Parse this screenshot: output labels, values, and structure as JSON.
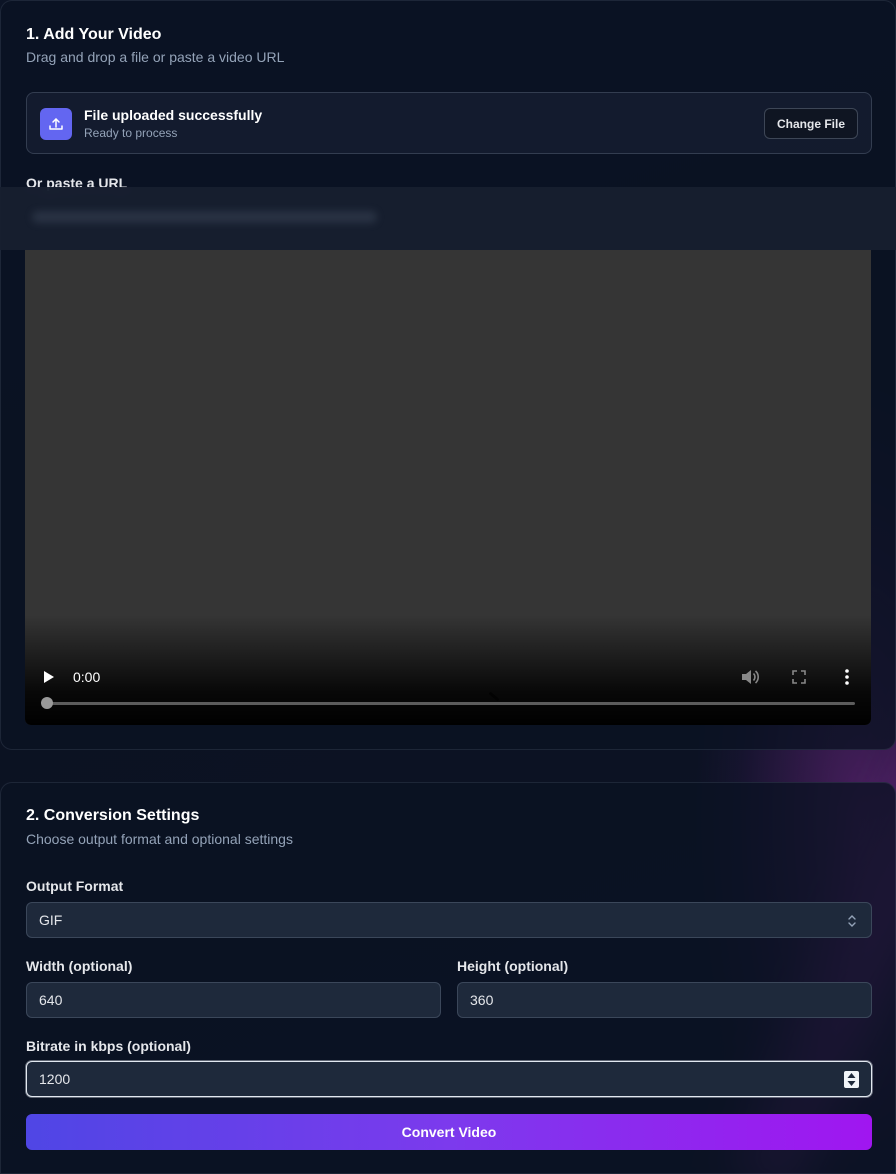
{
  "section1": {
    "title": "1. Add Your Video",
    "subtitle": "Drag and drop a file or paste a video URL",
    "upload": {
      "status_title": "File uploaded successfully",
      "status_sub": "Ready to process",
      "change_button": "Change File",
      "icon": "upload-icon"
    },
    "url_label": "Or paste a URL",
    "video": {
      "time": "0:00",
      "progress_fraction": 0,
      "controls": [
        "play-icon",
        "volume-icon",
        "fullscreen-icon",
        "more-vert-icon"
      ]
    }
  },
  "section2": {
    "title": "2. Conversion Settings",
    "subtitle": "Choose output format and optional settings",
    "output_format_label": "Output Format",
    "output_format_value": "GIF",
    "width_label": "Width (optional)",
    "width_value": "640",
    "height_label": "Height (optional)",
    "height_value": "360",
    "bitrate_label": "Bitrate in kbps (optional)",
    "bitrate_value": "1200",
    "convert_button": "Convert Video"
  },
  "colors": {
    "accent": "#6366f1",
    "button_gradient_start": "#4f46e5",
    "button_gradient_end": "#a016f0",
    "background": "#0c1426"
  }
}
